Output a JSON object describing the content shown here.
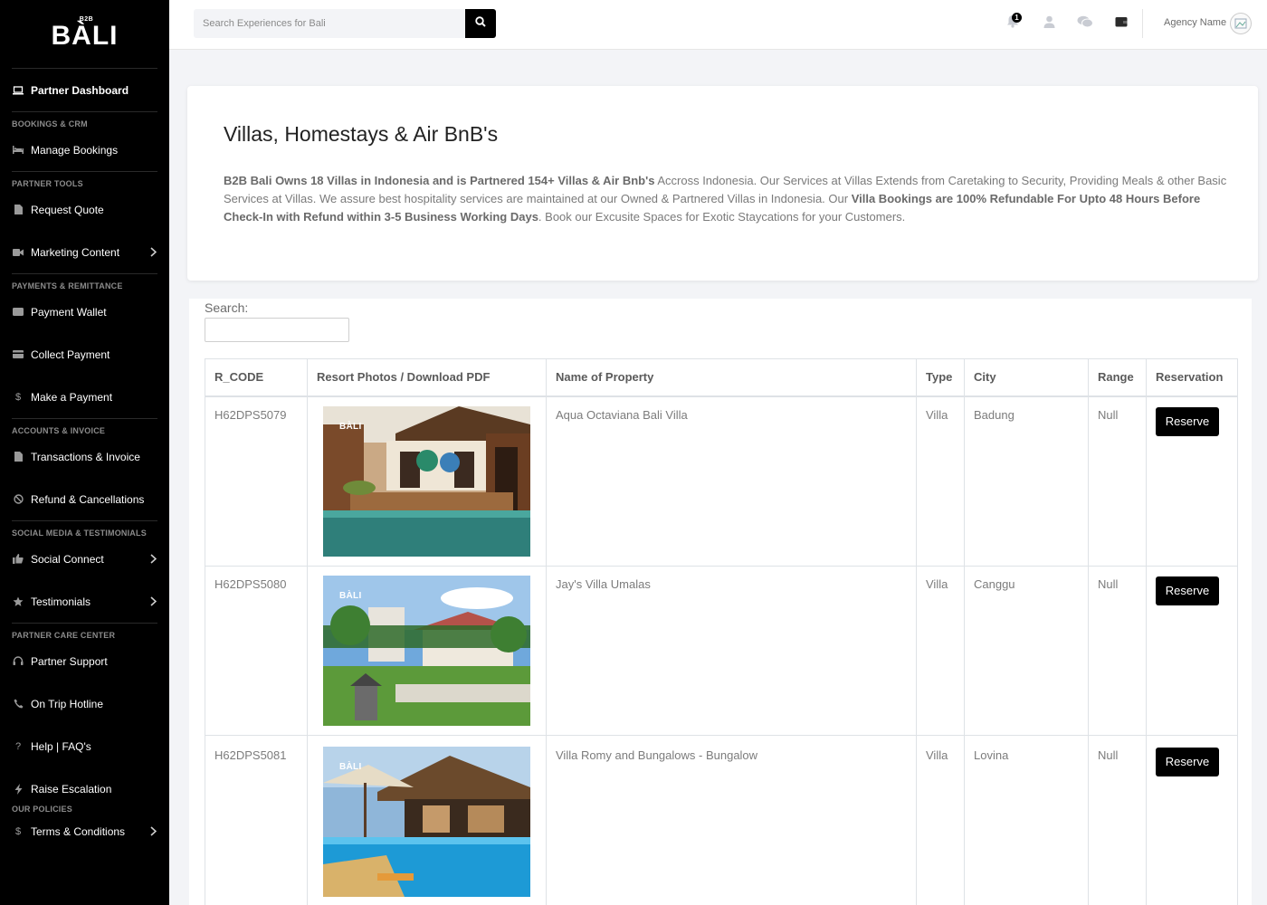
{
  "sidebar": {
    "logo_small": "B2B",
    "logo_big": "BÀLI",
    "dashboard": "Partner Dashboard",
    "sections": {
      "bookings": "BOOKINGS & CRM",
      "tools": "PARTNER TOOLS",
      "payments": "PAYMENTS & REMITTANCE",
      "accounts": "ACCOUNTS & INVOICE",
      "social": "SOCIAL MEDIA & TESTIMONIALS",
      "care": "PARTNER CARE CENTER",
      "policies": "OUR POLICIES"
    },
    "items": {
      "manage_bookings": "Manage Bookings",
      "request_quote": "Request Quote",
      "marketing_content": "Marketing Content",
      "payment_wallet": "Payment Wallet",
      "collect_payment": "Collect Payment",
      "make_payment": "Make a Payment",
      "transactions": "Transactions & Invoice",
      "refund": "Refund & Cancellations",
      "social_connect": "Social Connect",
      "testimonials": "Testimonials",
      "partner_support": "Partner Support",
      "on_trip_hotline": "On Trip Hotline",
      "help": "Help | FAQ's",
      "raise_escalation": "Raise Escalation",
      "terms": "Terms & Conditions"
    }
  },
  "topbar": {
    "search_placeholder": "Search Experiences for Bali",
    "notification_count": "1",
    "agency_name": "Agency Name"
  },
  "intro": {
    "title": "Villas, Homestays & Air BnB's",
    "p1_bold": "B2B Bali Owns 18 Villas in Indonesia and is Partnered 154+ Villas & Air Bnb's",
    "p2": " Accross Indonesia. Our Services at Villas Extends from Caretaking to Security, Providing Meals & other Basic Services at Villas. We assure best hospitality services are maintained at our Owned & Partnered Villas in Indonesia. Our ",
    "p3_bold": "Villa Bookings are 100% Refundable For Upto 48 Hours Before Check-In with Refund within 3-5 Business Working Days",
    "p4": ". Book our Excusite Spaces for Exotic Staycations for your Customers."
  },
  "table": {
    "search_label": "Search:",
    "headers": {
      "code": "R_CODE",
      "photos": "Resort Photos / Download PDF",
      "name": "Name of Property",
      "type": "Type",
      "city": "City",
      "range": "Range",
      "reservation": "Reservation"
    },
    "photo_tag": "BÀLI",
    "reserve_label": "Reserve",
    "rows": [
      {
        "code": "H62DPS5079",
        "name": "Aqua Octaviana Bali Villa",
        "type": "Villa",
        "city": "Badung",
        "range": "Null"
      },
      {
        "code": "H62DPS5080",
        "name": "Jay's Villa Umalas",
        "type": "Villa",
        "city": "Canggu",
        "range": "Null"
      },
      {
        "code": "H62DPS5081",
        "name": "Villa Romy and Bungalows - Bungalow",
        "type": "Villa",
        "city": "Lovina",
        "range": "Null"
      }
    ]
  }
}
